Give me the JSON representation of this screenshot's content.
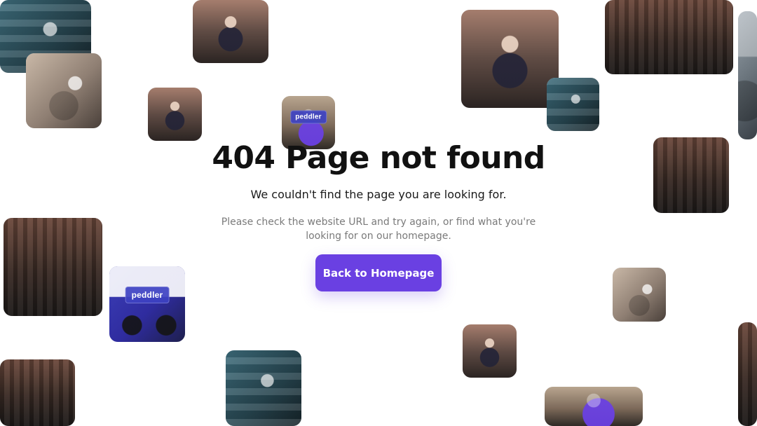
{
  "main": {
    "title": "404 Page not found",
    "subtitle": "We couldn't find the page you are looking for.",
    "help_text": "Please check the website URL and try again, or find what you're looking for on our homepage.",
    "cta_label": "Back to Homepage"
  },
  "theme": {
    "primary": "#6a40e2",
    "text": "#111111",
    "muted_text": "#7a7a7a",
    "background": "#ffffff"
  },
  "tiles": {
    "peddler_badge": "peddler"
  }
}
